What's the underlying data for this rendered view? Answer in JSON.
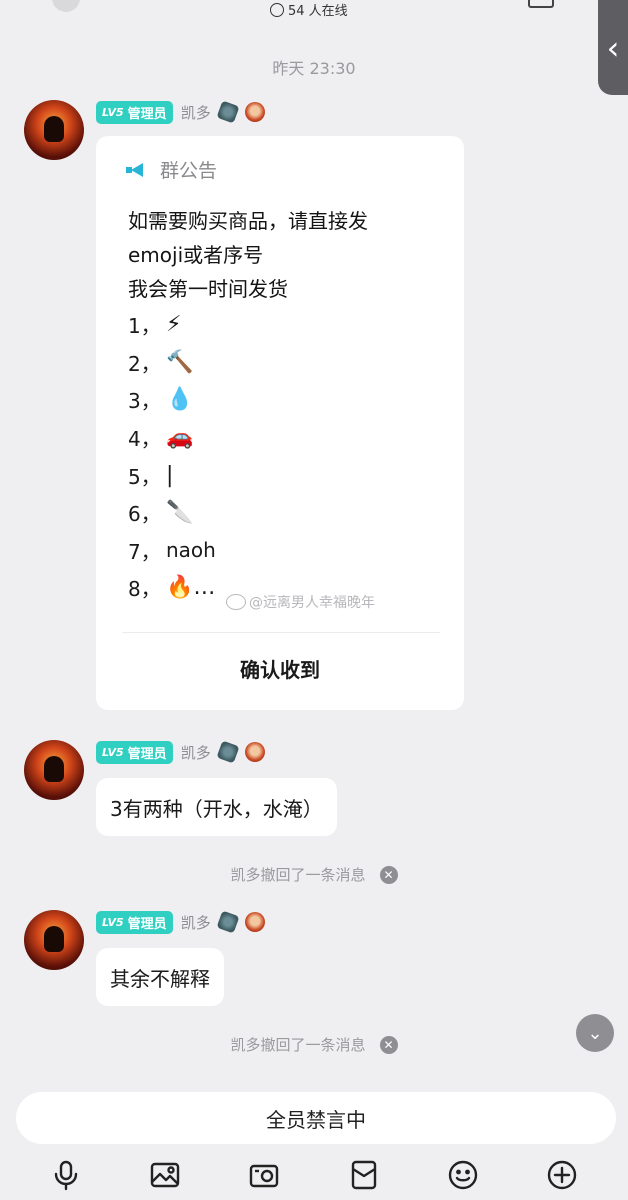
{
  "header": {
    "online_text": "54 人在线",
    "side_handle_glyph": "‹"
  },
  "timestamp": "昨天 23:30",
  "messages": [
    {
      "badge_level": "LV5",
      "badge_role": "管理员",
      "sender": "凯多",
      "announcement": {
        "title": "群公告",
        "lines": [
          "如需要购买商品，请直接发",
          "emoji或者序号",
          "我会第一时间发货"
        ],
        "items": [
          {
            "num": "1，",
            "content": "⚡"
          },
          {
            "num": "2，",
            "content": "🔨"
          },
          {
            "num": "3，",
            "content": "💧"
          },
          {
            "num": "4，",
            "content": "🚗"
          },
          {
            "num": "5，",
            "content": "|"
          },
          {
            "num": "6，",
            "content": "🔪"
          },
          {
            "num": "7，",
            "content": "naoh"
          },
          {
            "num": "8，",
            "content": "🔥…"
          }
        ],
        "confirm_label": "确认收到"
      }
    },
    {
      "badge_level": "LV5",
      "badge_role": "管理员",
      "sender": "凯多",
      "text": "3有两种（开水，水淹）"
    },
    {
      "badge_level": "LV5",
      "badge_role": "管理员",
      "sender": "凯多",
      "text": "其余不解释"
    }
  ],
  "recall_notices": [
    "凯多撤回了一条消息",
    "凯多撤回了一条消息"
  ],
  "watermark": "@远离男人幸福晚年",
  "mute_bar": "全员禁言中",
  "toolbar_icons": [
    "microphone-icon",
    "image-icon",
    "camera-icon",
    "red-packet-icon",
    "emoji-icon",
    "plus-icon"
  ]
}
